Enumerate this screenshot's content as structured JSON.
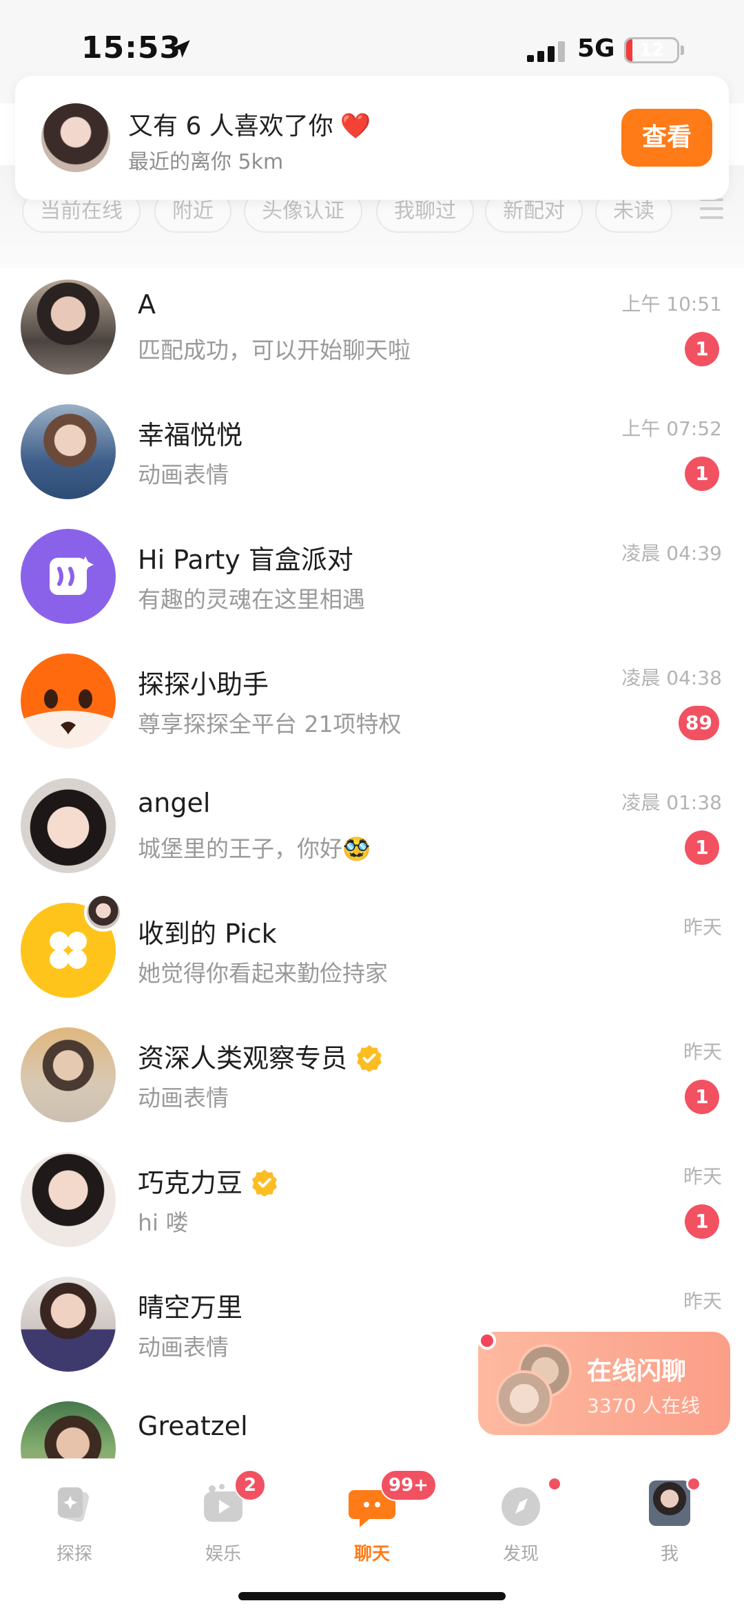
{
  "status_bar": {
    "time": "15:53",
    "network": "5G",
    "battery_level": "12"
  },
  "banner": {
    "title": "又有 6 人喜欢了你",
    "heart": "❤️",
    "subtitle": "最近的离你 5km",
    "button_label": "查看"
  },
  "filters": [
    "当前在线",
    "附近",
    "头像认证",
    "我聊过",
    "新配对",
    "未读"
  ],
  "conversations": [
    {
      "name": "A",
      "preview": "匹配成功，可以开始聊天啦",
      "time": "上午 10:51",
      "badge": "1"
    },
    {
      "name": "幸福悦悦",
      "preview": "动画表情",
      "time": "上午 07:52",
      "badge": "1"
    },
    {
      "name": "Hi Party 盲盒派对",
      "preview": "有趣的灵魂在这里相遇",
      "time": "凌晨 04:39",
      "badge": ""
    },
    {
      "name": "探探小助手",
      "preview": "尊享探探全平台 21项特权",
      "time": "凌晨 04:38",
      "badge": "89"
    },
    {
      "name": "angel",
      "preview": "城堡里的王子，你好🥸",
      "time": "凌晨 01:38",
      "badge": "1"
    },
    {
      "name": "收到的 Pick",
      "preview": "她觉得你看起来勤俭持家",
      "time": "昨天",
      "badge": ""
    },
    {
      "name": "资深人类观察专员",
      "preview": "动画表情",
      "time": "昨天",
      "badge": "1",
      "verified": true
    },
    {
      "name": "巧克力豆",
      "preview": "hi 喽",
      "time": "昨天",
      "badge": "1",
      "verified": true
    },
    {
      "name": "晴空万里",
      "preview": "动画表情",
      "time": "昨天",
      "badge": ""
    },
    {
      "name": "Greatzel",
      "preview": "",
      "time": "",
      "badge": ""
    }
  ],
  "online_chat": {
    "title": "在线闪聊",
    "subtitle": "3370 人在线"
  },
  "tabs": [
    {
      "label": "探探",
      "badge": ""
    },
    {
      "label": "娱乐",
      "badge": "2"
    },
    {
      "label": "聊天",
      "badge": "99+"
    },
    {
      "label": "发现",
      "badge": ""
    },
    {
      "label": "我",
      "badge": ""
    }
  ],
  "colors": {
    "accent": "#ff7b17",
    "badge": "#f25162",
    "verified": "#fbbd23",
    "party": "#8a62ea",
    "pick": "#ffc41c"
  }
}
